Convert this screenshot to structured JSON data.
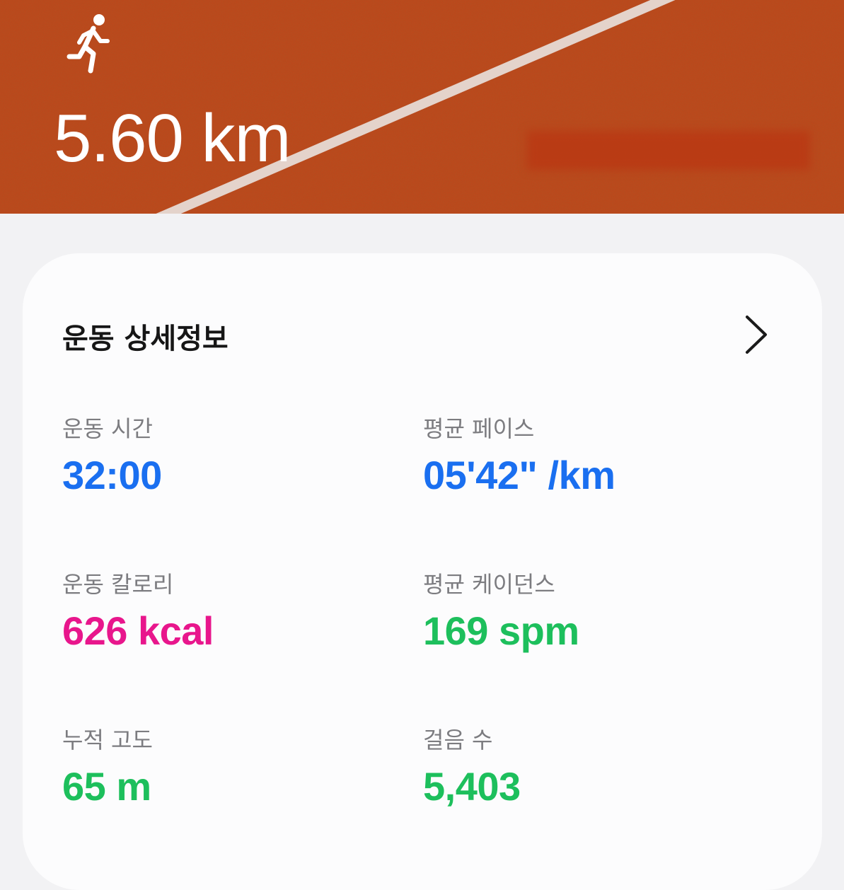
{
  "header": {
    "distance": "5.60 km",
    "icon": "runner-icon",
    "background_color": "#bf3f17"
  },
  "card": {
    "title": "운동 상세정보",
    "chevron_icon": "chevron-right-icon"
  },
  "stats": {
    "duration": {
      "label": "운동 시간",
      "value": "32:00",
      "color": "#1a6ff0"
    },
    "pace": {
      "label": "평균 페이스",
      "value": "05'42\" /km",
      "color": "#1a6ff0"
    },
    "calories": {
      "label": "운동 칼로리",
      "value": "626 kcal",
      "color": "#e8168c"
    },
    "cadence": {
      "label": "평균 케이던스",
      "value": "169 spm",
      "color": "#1dbf5c"
    },
    "elevation": {
      "label": "누적 고도",
      "value": "65 m",
      "color": "#1dbf5c"
    },
    "steps": {
      "label": "걸음 수",
      "value": "5,403",
      "color": "#1dbf5c"
    }
  }
}
